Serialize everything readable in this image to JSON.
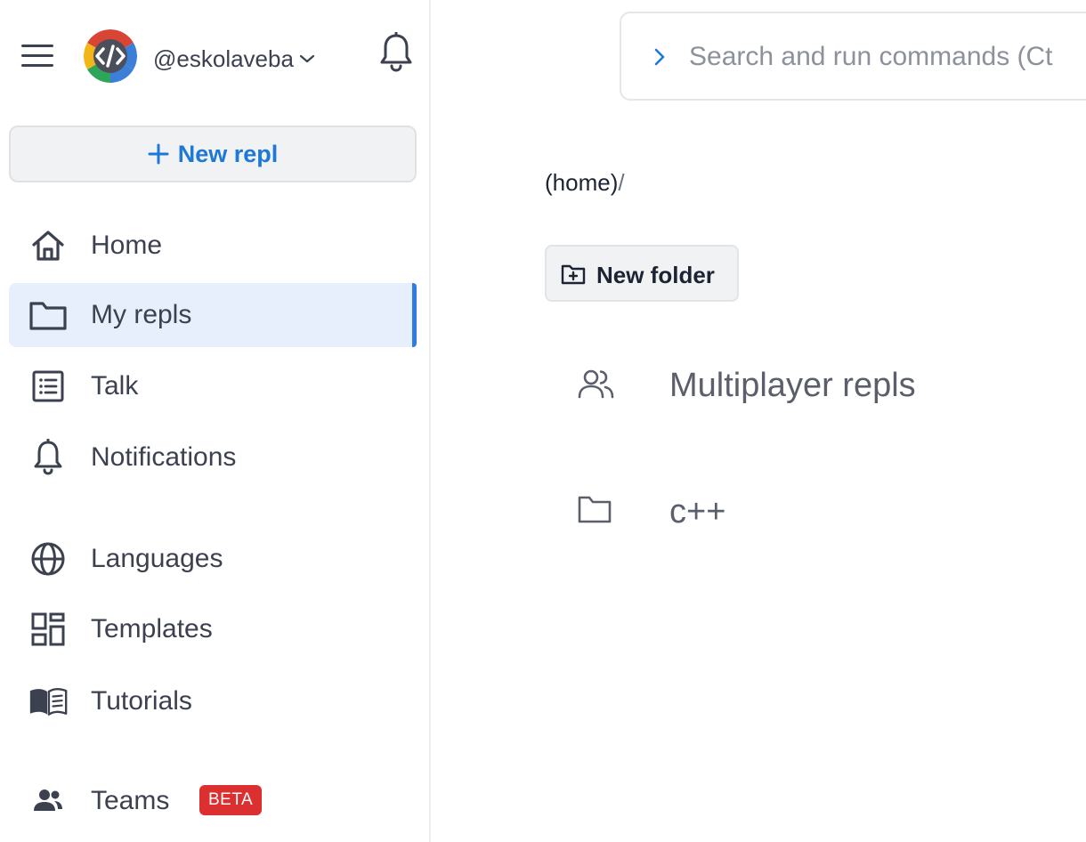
{
  "sidebar": {
    "username": "@eskolaveba",
    "new_repl_label": "New repl",
    "items": [
      {
        "label": "Home"
      },
      {
        "label": "My repls"
      },
      {
        "label": "Talk"
      },
      {
        "label": "Notifications"
      },
      {
        "label": "Languages"
      },
      {
        "label": "Templates"
      },
      {
        "label": "Tutorials"
      },
      {
        "label": "Teams"
      }
    ],
    "teams_badge": "BETA",
    "active_item": "My repls"
  },
  "search": {
    "placeholder": "Search and run commands (Ct"
  },
  "main": {
    "breadcrumb": "(home)",
    "breadcrumb_sep": "/",
    "new_folder_label": "New folder",
    "entries": [
      {
        "label": "Multiplayer repls",
        "icon": "users-icon"
      },
      {
        "label": "c++",
        "icon": "folder-icon"
      }
    ]
  },
  "colors": {
    "accent": "#1e78d6",
    "active_bg": "#e6effb",
    "active_bar": "#2f7de1",
    "badge": "#dc2f2f"
  }
}
